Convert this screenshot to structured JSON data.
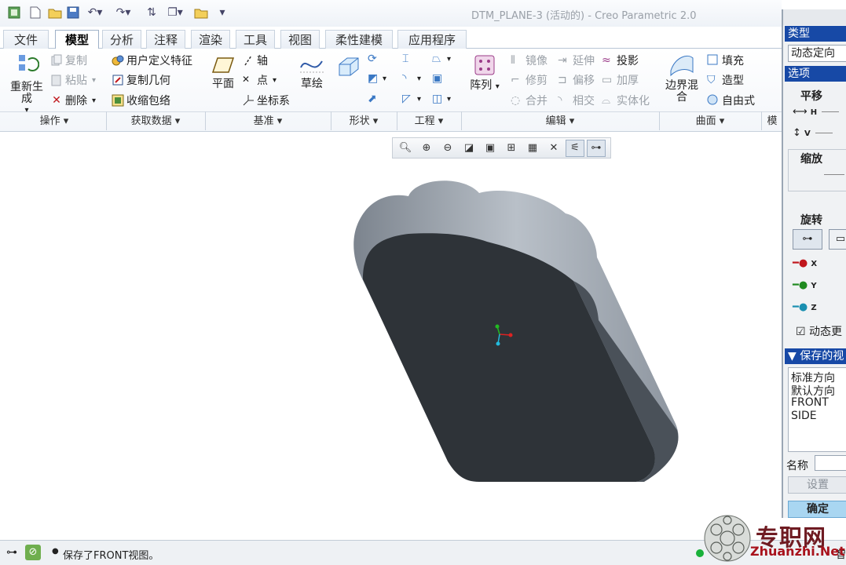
{
  "window": {
    "title": "DTM_PLANE-3 (活动的) - Creo Parametric 2.0"
  },
  "tabs": [
    "文件",
    "模型",
    "分析",
    "注释",
    "渲染",
    "工具",
    "视图",
    "柔性建模",
    "应用程序"
  ],
  "ribbon": {
    "operations": {
      "regenerate": "重新生成",
      "copy": "复制",
      "paste": "粘贴",
      "delete": "删除",
      "group": "操作"
    },
    "get_data": {
      "udf": "用户定义特征",
      "copy_geom": "复制几何",
      "shrinkwrap": "收缩包络",
      "group": "获取数据"
    },
    "datum": {
      "plane": "平面",
      "axis": "轴",
      "point": "点",
      "csys": "坐标系",
      "sketch": "草绘",
      "group": "基准"
    },
    "shapes": {
      "group": "形状"
    },
    "engineering": {
      "group": "工程"
    },
    "editing": {
      "pattern": "阵列",
      "mirror": "镜像",
      "extend": "延伸",
      "project": "投影",
      "trim": "修剪",
      "offset": "偏移",
      "thicken": "加厚",
      "merge": "合并",
      "intersect": "相交",
      "solidify": "实体化",
      "group": "编辑"
    },
    "surfaces": {
      "boundary_blend": "边界混合",
      "fill": "填充",
      "style": "造型",
      "freestyle": "自由式",
      "group": "曲面"
    },
    "model_intent": {
      "group": "模"
    }
  },
  "view_panel": {
    "type_header": "类型",
    "type_value": "动态定向",
    "options_header": "选项",
    "pan_label": "平移",
    "pan_h": "H",
    "pan_v": "V",
    "zoom_label": "缩放",
    "spin_label": "旋转",
    "axis_x": "X",
    "axis_y": "Y",
    "axis_z": "Z",
    "dynamic_update": "动态更",
    "saved_views_header": "保存的视",
    "saved_views": [
      "标准方向",
      "默认方向",
      "FRONT",
      "SIDE"
    ],
    "name_label": "名称",
    "set_button": "设置",
    "ok_button": "确定"
  },
  "status": {
    "message": "保存了FRONT视图。",
    "right_label": "智"
  },
  "watermark": {
    "text": "专职网",
    "url": "Zhuanzhi.Net"
  },
  "colors": {
    "panel_header": "#1749a6",
    "model_face": "#2e3338",
    "model_side": "#9aa2ac",
    "ok_button": "#a9d6f1"
  }
}
